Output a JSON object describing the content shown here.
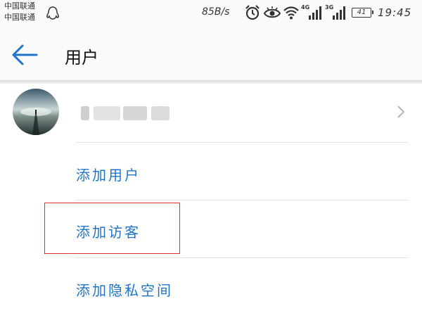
{
  "status_bar": {
    "carrier_1": "中国联通",
    "carrier_2": "中国联通",
    "speed": "85B/s",
    "signal_1_label": "4G",
    "signal_2_label": "3G",
    "battery": "41",
    "time": "19:45"
  },
  "header": {
    "title": "用户"
  },
  "user_row": {
    "name": ""
  },
  "menu": {
    "add_user": "添加用户",
    "add_guest": "添加访客",
    "add_private_space": "添加隐私空间"
  },
  "colors": {
    "accent": "#1f74c7",
    "highlight": "#d93030"
  }
}
